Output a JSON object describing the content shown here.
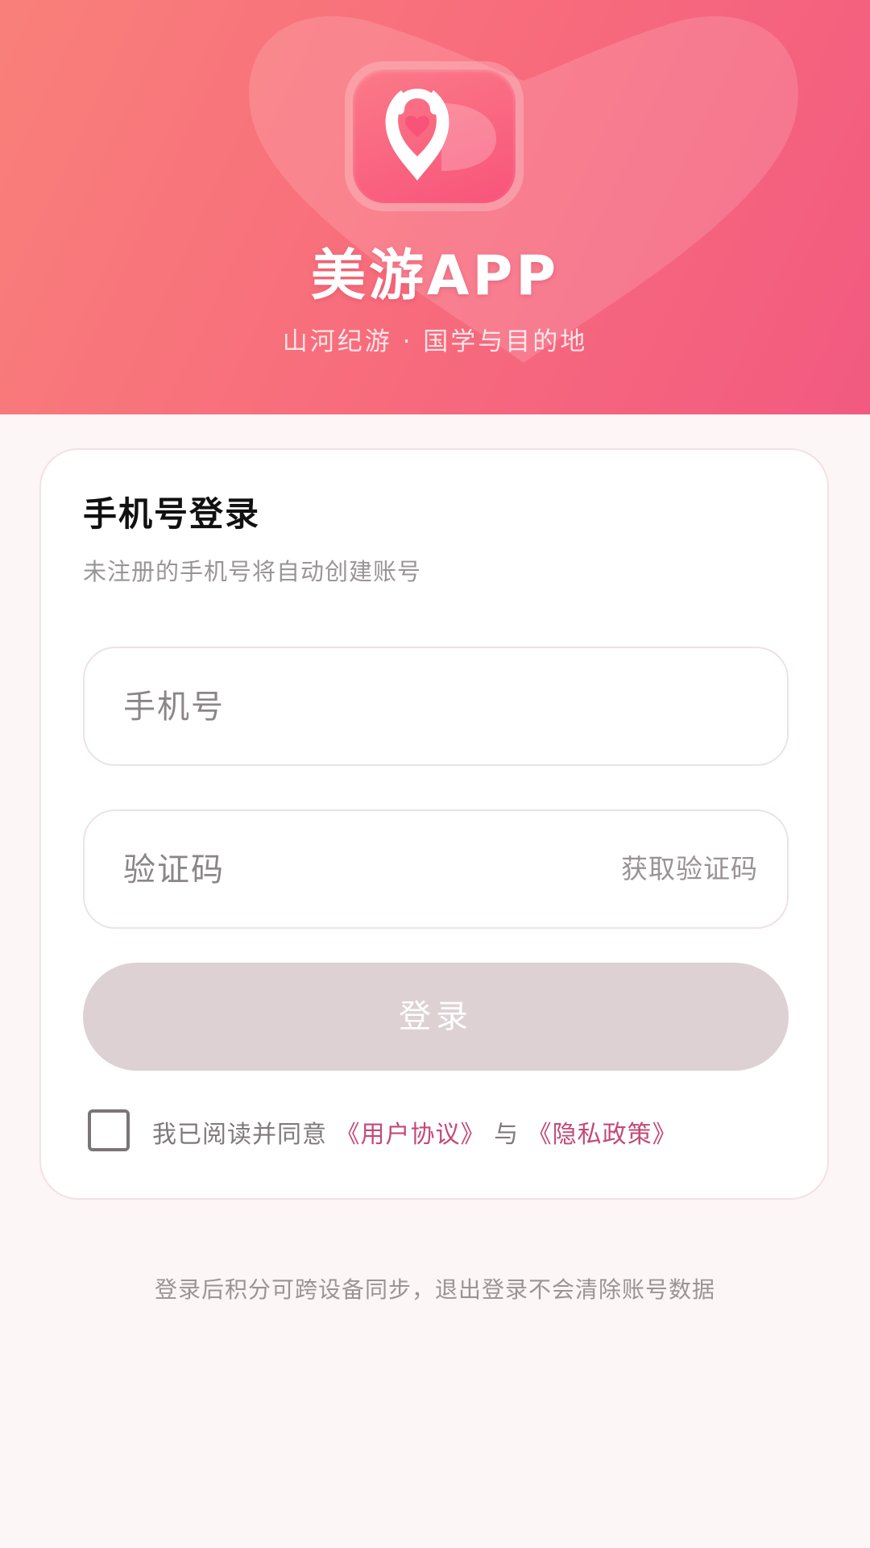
{
  "header": {
    "app_title": "美游APP",
    "slogan": "山河纪游 · 国学与目的地",
    "gradient_colors": [
      "#f9807a",
      "#f25a80"
    ]
  },
  "login_card": {
    "title": "手机号登录",
    "subtitle": "未注册的手机号将自动创建账号",
    "phone_placeholder": "手机号",
    "code_placeholder": "验证码",
    "get_code_label": "获取验证码",
    "login_label": "登录",
    "agreement": {
      "checked": false,
      "prefix": "我已阅读并同意",
      "user_agreement": "《用户协议》",
      "connector": "与",
      "privacy_policy": "《隐私政策》"
    }
  },
  "footer_note": "登录后积分可跨设备同步，退出登录不会清除账号数据",
  "colors": {
    "accent_link": "#c34a78",
    "login_button_disabled": "#ddd1d4",
    "page_background": "#fcf6f6"
  },
  "icons": {
    "logo": "heart-location-pin-icon",
    "hero_background": "heart-shape"
  }
}
